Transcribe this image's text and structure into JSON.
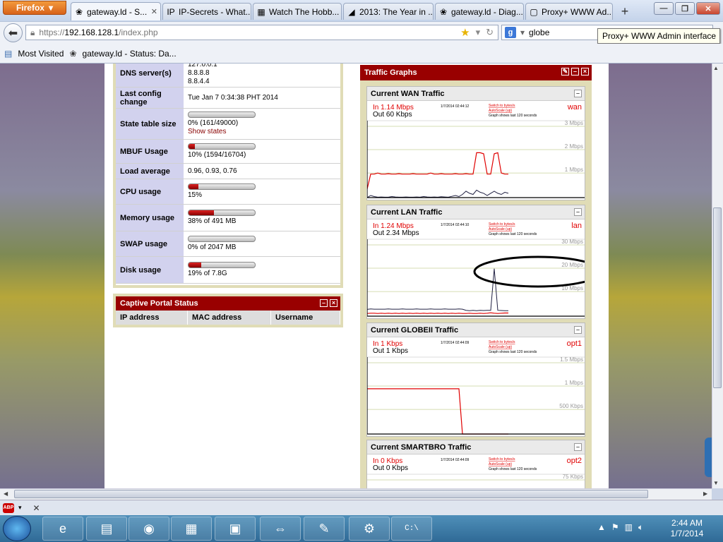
{
  "browser": {
    "firefox_label": "Firefox",
    "tabs": [
      {
        "icon": "pfsense-icon",
        "glyph": "❀",
        "label": "gateway.ld - S...",
        "active": true
      },
      {
        "icon": "ipsecrets-icon",
        "glyph": "IP",
        "label": "IP-Secrets - What..."
      },
      {
        "icon": "film-icon",
        "glyph": "▦",
        "label": "Watch The Hobb..."
      },
      {
        "icon": "flag-icon",
        "glyph": "◢",
        "label": "2013: The Year in ..."
      },
      {
        "icon": "pfsense-icon",
        "glyph": "❀",
        "label": "gateway.ld - Diag..."
      },
      {
        "icon": "blank-page-icon",
        "glyph": "▢",
        "label": "Proxy+ WWW Ad..."
      }
    ],
    "url_scheme": "https://",
    "url_host": "192.168.128.1",
    "url_path": "/index.php",
    "search_value": "globe",
    "tooltip": "Proxy+ WWW Admin interface",
    "bookmarks": [
      {
        "icon": "bookmarks-icon",
        "label": "Most Visited"
      },
      {
        "icon": "pfsense-icon",
        "label": "gateway.ld - Status: Da..."
      }
    ]
  },
  "status": {
    "rows": [
      {
        "key": "dns",
        "label": "DNS server(s)",
        "lines": [
          "127.0.0.1",
          "8.8.8.8",
          "8.8.4.4"
        ]
      },
      {
        "key": "config",
        "label": "Last config change",
        "value": "Tue Jan 7 0:34:38 PHT 2014"
      },
      {
        "key": "state",
        "label": "State table size",
        "bar": 0.0,
        "value": "0% (161/49000)",
        "link": "Show states"
      },
      {
        "key": "mbuf",
        "label": "MBUF Usage",
        "bar": 0.1,
        "value": "10% (1594/16704)"
      },
      {
        "key": "load",
        "label": "Load average",
        "value": "0.96, 0.93, 0.76"
      },
      {
        "key": "cpu",
        "label": "CPU usage",
        "bar": 0.15,
        "value": "15%"
      },
      {
        "key": "memory",
        "label": "Memory usage",
        "bar": 0.38,
        "value": "38% of 491 MB"
      },
      {
        "key": "swap",
        "label": "SWAP usage",
        "bar": 0.0,
        "value": "0% of 2047 MB"
      },
      {
        "key": "disk",
        "label": "Disk usage",
        "bar": 0.19,
        "value": "19% of 7.8G"
      }
    ]
  },
  "captive": {
    "title": "Captive Portal Status",
    "columns": [
      "IP address",
      "MAC address",
      "Username"
    ]
  },
  "traffic": {
    "title": "Traffic Graphs",
    "graphs": [
      {
        "key": "wan",
        "title": "Current WAN Traffic",
        "in": "In   1.14 Mbps",
        "out": "Out  60 Kbps",
        "iface": "wan",
        "date": "1/7/2014 02:44:12",
        "scale": "Switch to bytes/s",
        "autoscale": "AutoScale (up)",
        "shows": "Graph shows last 120 seconds",
        "grid": [
          "3 Mbps",
          "2 Mbps",
          "1 Mbps"
        ],
        "max": 3.6,
        "in_series": [
          0.4,
          1.1,
          1.1,
          1.15,
          1.1,
          1.1,
          1.12,
          1.1,
          1.1,
          1.12,
          1.1,
          1.1,
          1.1,
          1.12,
          1.1,
          1.1,
          1.1,
          1.1,
          1.15,
          1.1,
          1.1,
          1.12,
          1.1,
          1.1,
          1.1,
          1.12,
          1.1,
          1.1,
          1.12,
          1.1,
          1.1,
          2.1,
          2.1,
          2.05,
          1.1,
          1.1,
          2.05,
          2.1,
          1.15,
          1.1,
          1.1
        ],
        "out_series": [
          0.0,
          0.1,
          0.05,
          0.02,
          0.03,
          0.02,
          0.02,
          0.05,
          0.03,
          0.02,
          0.02,
          0.03,
          0.02,
          0.02,
          0.03,
          0.02,
          0.05,
          0.03,
          0.02,
          0.03,
          0.02,
          0.04,
          0.03,
          0.02,
          0.06,
          0.1,
          0.05,
          0.15,
          0.3,
          0.2,
          0.15,
          0.35,
          0.25,
          0.2,
          0.1,
          0.2,
          0.3,
          0.2,
          0.15,
          0.25,
          0.2
        ]
      },
      {
        "key": "lan",
        "title": "Current LAN Traffic",
        "in": "In   1.24 Mbps",
        "out": "Out  2.34 Mbps",
        "iface": "lan",
        "date": "1/7/2014 02:44:10",
        "scale": "Switch to bytes/s",
        "autoscale": "AutoScale (up)",
        "shows": "Graph shows last 120 seconds",
        "grid": [
          "30 Mbps",
          "20 Mbps",
          "10 Mbps"
        ],
        "max": 34,
        "in_series": [
          1.2,
          1.3,
          1.3,
          1.2,
          1.3,
          1.2,
          1.3,
          1.2,
          1.3,
          1.2,
          1.3,
          1.2,
          1.3,
          1.2,
          1.3,
          1.2,
          1.3,
          1.2,
          1.3,
          1.2,
          1.3,
          1.2,
          1.3,
          1.2,
          1.3,
          1.2,
          1.3,
          1.2,
          1.2,
          1.3,
          1.2,
          1.2,
          1.3,
          1.2,
          1.3,
          1.5,
          1.3,
          1.2,
          1.3,
          1.4,
          1.4
        ],
        "out_series": [
          3.0,
          3.2,
          3.1,
          3.1,
          3.1,
          3.1,
          3.2,
          3.1,
          3.1,
          3.1,
          3.2,
          3.1,
          3.1,
          3.1,
          3.2,
          3.1,
          3.1,
          3.1,
          3.2,
          3.1,
          3.1,
          3.1,
          3.2,
          3.1,
          3.1,
          3.1,
          3.2,
          3.1,
          2.6,
          2.4,
          2.6,
          2.4,
          2.6,
          2.5,
          2.6,
          2.6,
          21.0,
          2.6,
          2.5,
          2.4,
          2.4
        ]
      },
      {
        "key": "opt1",
        "title": "Current GLOBEII Traffic",
        "in": "In    1 Kbps",
        "out": "Out  1 Kbps",
        "iface": "opt1",
        "date": "1/7/2014 02:44:09",
        "scale": "Switch to bytes/s",
        "autoscale": "AutoScale (up)",
        "shows": "Graph shows last 120 seconds",
        "grid": [
          "1.5 Mbps",
          "1 Mbps",
          "500 Kbps"
        ],
        "max": 1.7,
        "in_series": [
          1.0,
          1.0,
          1.0,
          1.0,
          1.0,
          1.0,
          1.0,
          1.0,
          1.0,
          1.0,
          1.0,
          1.0,
          1.0,
          1.0,
          1.0,
          1.0,
          1.0,
          1.0,
          1.0,
          1.0,
          1.0,
          1.0,
          1.0,
          1.0,
          1.0,
          1.0,
          1.0,
          0.0,
          0.0,
          0.0,
          0.0,
          0.0,
          0.0,
          0.0,
          0.0,
          0.0,
          0.0,
          0.0,
          0.0,
          0.0,
          0.0
        ],
        "out_series": [
          0.0,
          0.0,
          0.0,
          0.0,
          0.0,
          0.0,
          0.0,
          0.0,
          0.0,
          0.0,
          0.0,
          0.0,
          0.0,
          0.0,
          0.0,
          0.0,
          0.0,
          0.0,
          0.0,
          0.0,
          0.0,
          0.0,
          0.0,
          0.0,
          0.0,
          0.0,
          0.0,
          0.0,
          0.0,
          0.0,
          0.0,
          0.0,
          0.0,
          0.0,
          0.0,
          0.0,
          0.0,
          0.0,
          0.0,
          0.0,
          0.0
        ]
      },
      {
        "key": "opt2",
        "title": "Current SMARTBRO Traffic",
        "in": "In    0 Kbps",
        "out": "Out  0 Kbps",
        "iface": "opt2",
        "date": "1/7/2014 02:44:09",
        "scale": "Switch to bytes/s",
        "autoscale": "AutoScale (up)",
        "shows": "Graph shows last 120 seconds",
        "grid": [
          "75 Kbps"
        ],
        "max": 100,
        "in_series": [],
        "out_series": []
      }
    ]
  },
  "taskbar": {
    "apps": [
      {
        "icon": "ie-icon",
        "glyph": "e"
      },
      {
        "icon": "explorer-icon",
        "glyph": "▤"
      },
      {
        "icon": "firefox-icon",
        "glyph": "◉"
      },
      {
        "icon": "control-panel-icon",
        "glyph": "▦"
      },
      {
        "icon": "virtualbox-icon",
        "glyph": "▣"
      },
      {
        "icon": "teamviewer-icon",
        "glyph": "⇔"
      },
      {
        "icon": "notepad-icon",
        "glyph": "✎"
      },
      {
        "icon": "settings-icon",
        "glyph": "⚙"
      },
      {
        "icon": "cmd-icon",
        "glyph": "C:\\"
      }
    ],
    "time": "2:44 AM",
    "date": "1/7/2014"
  },
  "colors": {
    "panel_red": "#990000",
    "in_line": "#e00000",
    "out_line": "#222244",
    "label_bg": "#d2d2ee"
  }
}
